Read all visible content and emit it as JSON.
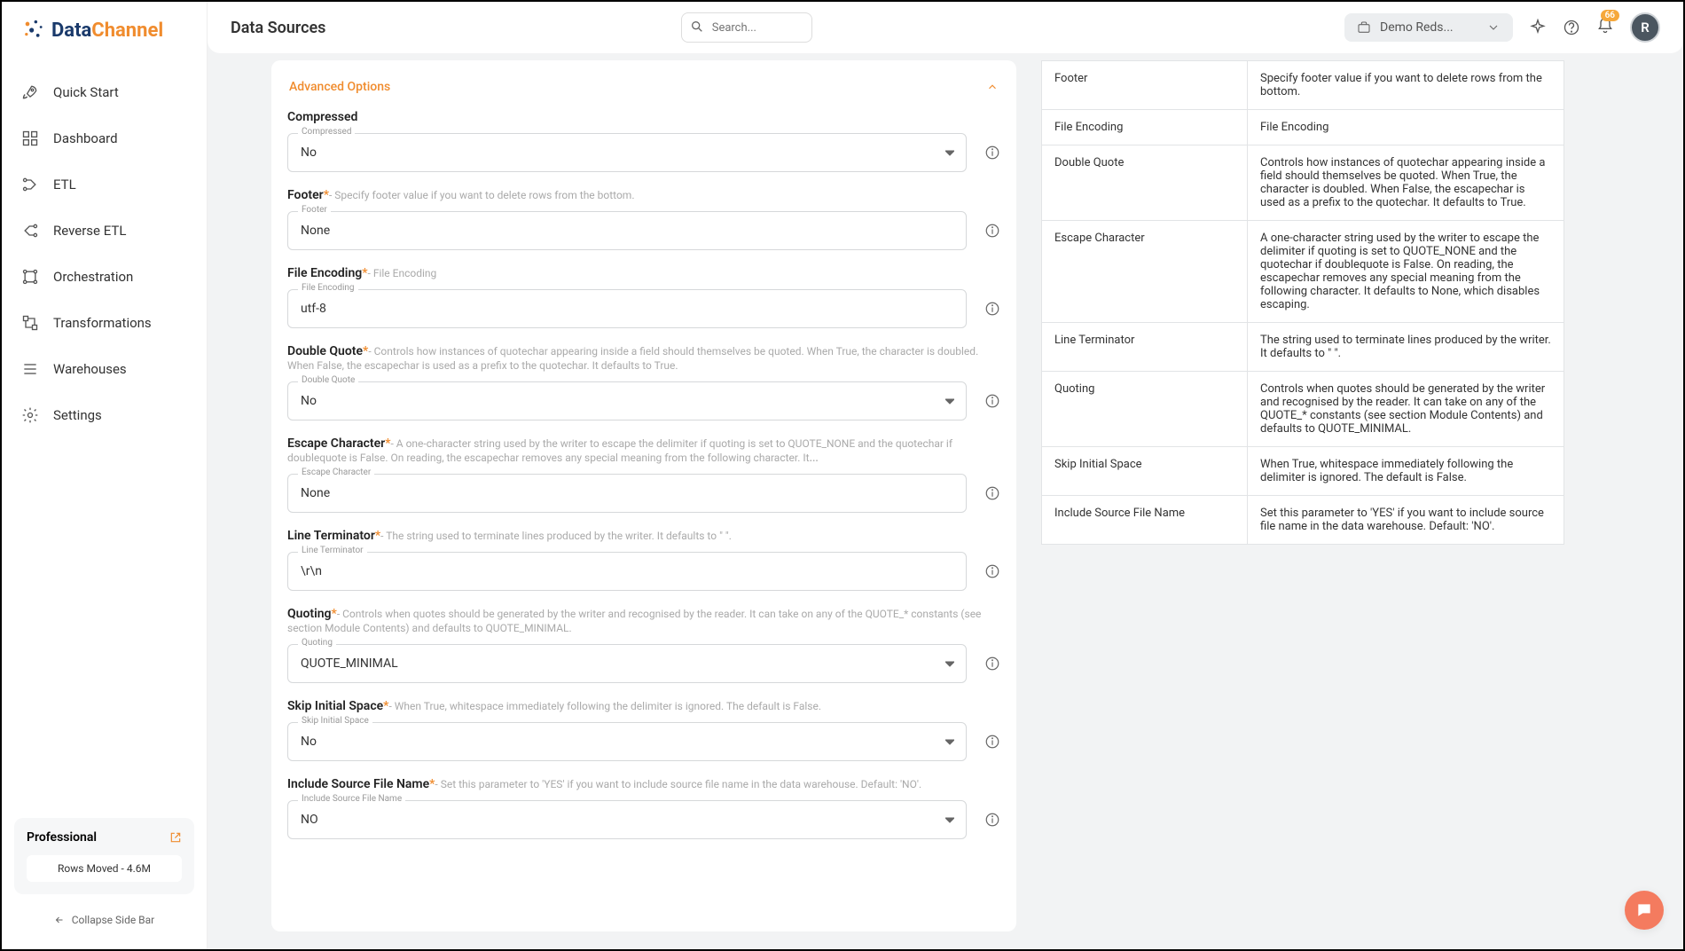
{
  "brand": {
    "left": "Data",
    "right": "Channel"
  },
  "sidebar": {
    "items": [
      {
        "label": "Quick Start"
      },
      {
        "label": "Dashboard"
      },
      {
        "label": "ETL"
      },
      {
        "label": "Reverse ETL"
      },
      {
        "label": "Orchestration"
      },
      {
        "label": "Transformations"
      },
      {
        "label": "Warehouses"
      },
      {
        "label": "Settings"
      }
    ],
    "plan": {
      "name": "Professional",
      "sub": "Rows Moved - 4.6M"
    },
    "collapse": "Collapse Side Bar"
  },
  "header": {
    "title": "Data Sources",
    "search_placeholder": "Search...",
    "demo_label": "Demo Reds...",
    "badge": "66",
    "avatar": "R"
  },
  "adv": {
    "title": "Advanced Options",
    "compressed": {
      "label": "Compressed",
      "float": "Compressed",
      "value": "No"
    },
    "footer": {
      "label": "Footer",
      "hint": "- Specify footer value if you want to delete rows from the bottom.",
      "float": "Footer",
      "value": "None"
    },
    "file_encoding": {
      "label": "File Encoding",
      "hint": "- File Encoding",
      "float": "File Encoding",
      "value": "utf-8"
    },
    "double_quote": {
      "label": "Double Quote",
      "hint": "- Controls how instances of quotechar appearing inside a field should themselves be quoted. When True, the character is doubled. When False, the escapechar is used as a prefix to the quotechar. It defaults to True.",
      "float": "Double Quote",
      "value": "No"
    },
    "escape_char": {
      "label": "Escape Character",
      "hint": "- A one-character string used by the writer to escape the delimiter if quoting is set to QUOTE_NONE and the quotechar if doublequote is False. On reading, the escapechar removes any special meaning from the following character. It",
      "more": "...",
      "float": "Escape Character",
      "value": "None"
    },
    "line_term": {
      "label": "Line Terminator",
      "hint": "- The string used to terminate lines produced by the writer. It defaults to \" \".",
      "float": "Line Terminator",
      "value": "\\r\\n"
    },
    "quoting": {
      "label": "Quoting",
      "hint": "- Controls when quotes should be generated by the writer and recognised by the reader. It can take on any of the QUOTE_* constants (see section Module Contents) and defaults to QUOTE_MINIMAL.",
      "float": "Quoting",
      "value": "QUOTE_MINIMAL"
    },
    "skip_initial": {
      "label": "Skip Initial Space",
      "hint": "- When True, whitespace immediately following the delimiter is ignored. The default is False.",
      "float": "Skip Initial Space",
      "value": "No"
    },
    "include_src": {
      "label": "Include Source File Name",
      "hint": "- Set this parameter to 'YES' if you want to include source file name in the data warehouse. Default: 'NO'.",
      "float": "Include Source File Name",
      "value": "NO"
    }
  },
  "help_rows": [
    {
      "k": "Footer",
      "v": "Specify footer value if you want to delete rows from the bottom."
    },
    {
      "k": "File Encoding",
      "v": "File Encoding"
    },
    {
      "k": "Double Quote",
      "v": "Controls how instances of quotechar appearing inside a field should themselves be quoted. When True, the character is doubled. When False, the escapechar is used as a prefix to the quotechar. It defaults to True."
    },
    {
      "k": "Escape Character",
      "v": "A one-character string used by the writer to escape the delimiter if quoting is set to QUOTE_NONE and the quotechar if doublequote is False. On reading, the escapechar removes any special meaning from the following character. It defaults to None, which disables escaping."
    },
    {
      "k": "Line Terminator",
      "v": "The string used to terminate lines produced by the writer. It defaults to \" \"."
    },
    {
      "k": "Quoting",
      "v": "Controls when quotes should be generated by the writer and recognised by the reader. It can take on any of the QUOTE_* constants (see section Module Contents) and defaults to QUOTE_MINIMAL."
    },
    {
      "k": "Skip Initial Space",
      "v": "When True, whitespace immediately following the delimiter is ignored. The default is False."
    },
    {
      "k": "Include Source File Name",
      "v": "Set this parameter to 'YES' if you want to include source file name in the data warehouse. Default: 'NO'."
    }
  ]
}
